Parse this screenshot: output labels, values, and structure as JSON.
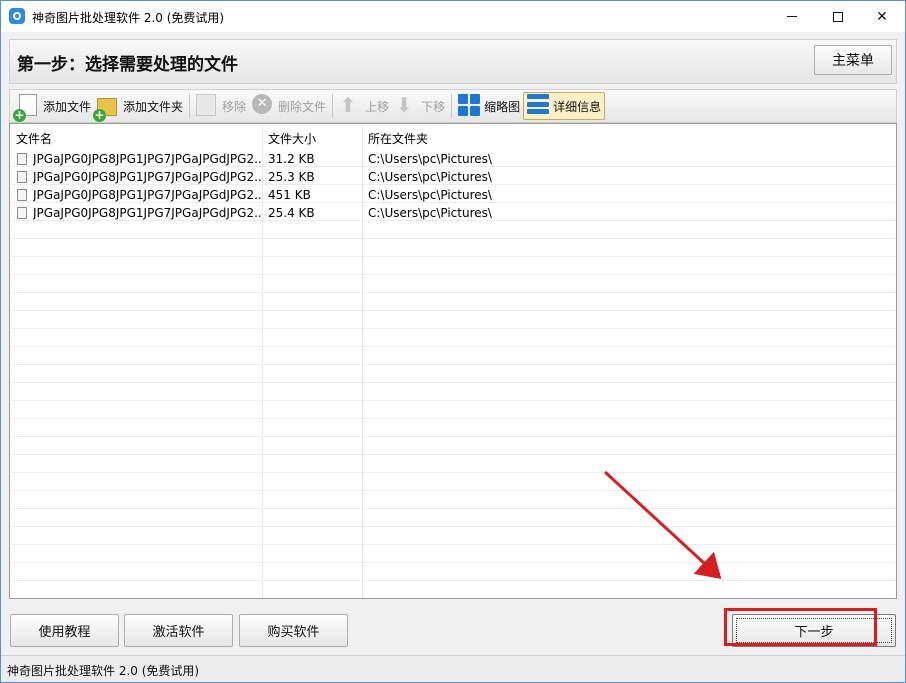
{
  "window": {
    "title": "神奇图片批处理软件 2.0 (免费试用)",
    "controls": {
      "minimize": "minimize",
      "maximize": "maximize",
      "close": "✕"
    }
  },
  "header": {
    "step_title": "第一步：选择需要处理的文件",
    "main_menu_label": "主菜单"
  },
  "toolbar": {
    "items": [
      {
        "label": "添加文件",
        "icon": "add-file-icon",
        "enabled": true
      },
      {
        "label": "添加文件夹",
        "icon": "add-folder-icon",
        "enabled": true
      },
      {
        "label": "移除",
        "icon": "remove-icon",
        "enabled": false
      },
      {
        "label": "删除文件",
        "icon": "delete-icon",
        "enabled": false
      },
      {
        "label": "上移",
        "icon": "arrow-up-icon",
        "enabled": false
      },
      {
        "label": "下移",
        "icon": "arrow-down-icon",
        "enabled": false
      },
      {
        "label": "缩略图",
        "icon": "grid-view-icon",
        "enabled": true
      },
      {
        "label": "详细信息",
        "icon": "list-view-icon",
        "enabled": true,
        "active": true
      }
    ]
  },
  "table": {
    "columns": [
      "文件名",
      "文件大小",
      "所在文件夹"
    ],
    "rows": [
      {
        "name": "JPGaJPG0JPG8JPG1JPG7JPGaJPGdJPG2...",
        "size": "31.2 KB",
        "folder": "C:\\Users\\pc\\Pictures\\"
      },
      {
        "name": "JPGaJPG0JPG8JPG1JPG7JPGaJPGdJPG2...",
        "size": "25.3 KB",
        "folder": "C:\\Users\\pc\\Pictures\\"
      },
      {
        "name": "JPGaJPG0JPG8JPG1JPG7JPGaJPGdJPG2...",
        "size": "451 KB",
        "folder": "C:\\Users\\pc\\Pictures\\"
      },
      {
        "name": "JPGaJPG0JPG8JPG1JPG7JPGaJPGdJPG2...",
        "size": "25.4 KB",
        "folder": "C:\\Users\\pc\\Pictures\\"
      }
    ]
  },
  "footer": {
    "buttons": [
      "使用教程",
      "激活软件",
      "购买软件"
    ],
    "next_label": "下一步"
  },
  "statusbar": {
    "text": "神奇图片批处理软件 2.0 (免费试用)"
  },
  "colors": {
    "accent": "#1e78d2",
    "highlight_red": "#d42020",
    "active_tab_bg": "#fdf0c8"
  }
}
